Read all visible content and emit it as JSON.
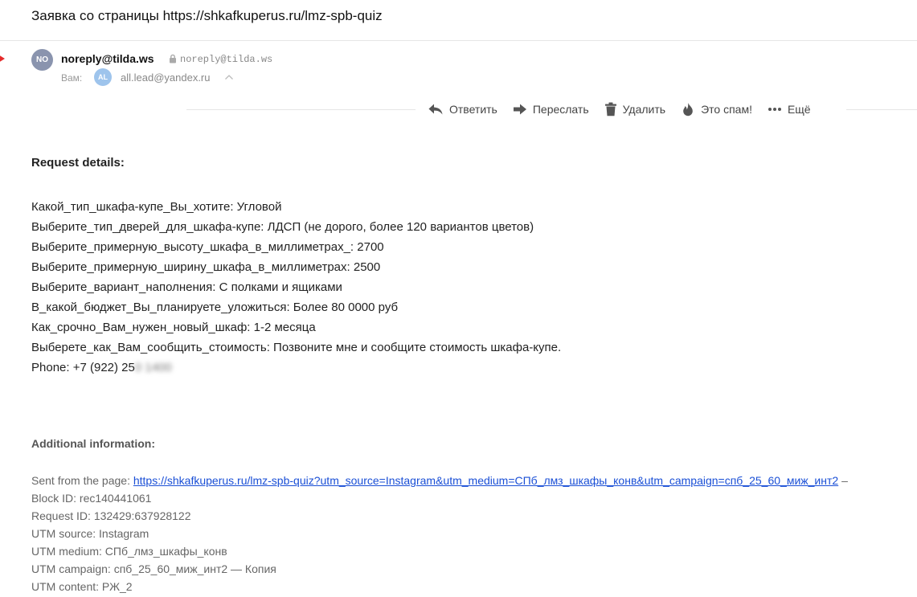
{
  "subject": "Заявка со страницы https://shkafkuperus.ru/lmz-spb-quiz",
  "sender": {
    "avatar_initials": "NO",
    "name": "noreply@tilda.ws",
    "address": "noreply@tilda.ws"
  },
  "recipient": {
    "to_label": "Вам:",
    "avatar_initials": "AL",
    "address": "all.lead@yandex.ru"
  },
  "toolbar": {
    "reply": "Ответить",
    "forward": "Переслать",
    "delete": "Удалить",
    "spam": "Это спам!",
    "more": "Ещё"
  },
  "request": {
    "heading": "Request details:",
    "fields": [
      "Какой_тип_шкафа-купе_Вы_хотите: Угловой",
      "Выберите_тип_дверей_для_шкафа-купе: ЛДСП (не дорого, более 120 вариантов цветов)",
      "Выберите_примерную_высоту_шкафа_в_миллиметрах_: 2700",
      "Выберите_примерную_ширину_шкафа_в_миллиметрах: 2500",
      "Выберите_вариант_наполнения: С полками и ящиками",
      "В_какой_бюджет_Вы_планируете_уложиться: Более 80 0000 руб",
      "Как_срочно_Вам_нужен_новый_шкаф: 1-2 месяца",
      "Выберете_как_Вам_сообщить_стоимость: Позвоните мне и сообщите стоимость шкафа-купе."
    ],
    "phone_visible": "Phone: +7 (922) 25",
    "phone_blurred": "0 1400"
  },
  "additional": {
    "heading": "Additional information:",
    "sent_from_label": "Sent from the page: ",
    "sent_from_url": "https://shkafkuperus.ru/lmz-spb-quiz?utm_source=Instagram&utm_medium=СПб_лмз_шкафы_конв&utm_campaign=спб_25_60_миж_инт2",
    "sent_from_suffix": " –",
    "block_id": "Block ID: rec140441061",
    "request_id": "Request ID: 132429:637928122",
    "utm_source": "UTM source: Instagram",
    "utm_medium": "UTM medium: СПб_лмз_шкафы_конв",
    "utm_campaign": "UTM campaign: спб_25_60_миж_инт2 — Копия",
    "utm_content": "UTM content: РЖ_2"
  },
  "colors": {
    "link": "#1a4fd6",
    "flag": "#e52b2b",
    "sender_avatar": "#8a94ae",
    "recipient_avatar": "#9ec4ec"
  }
}
